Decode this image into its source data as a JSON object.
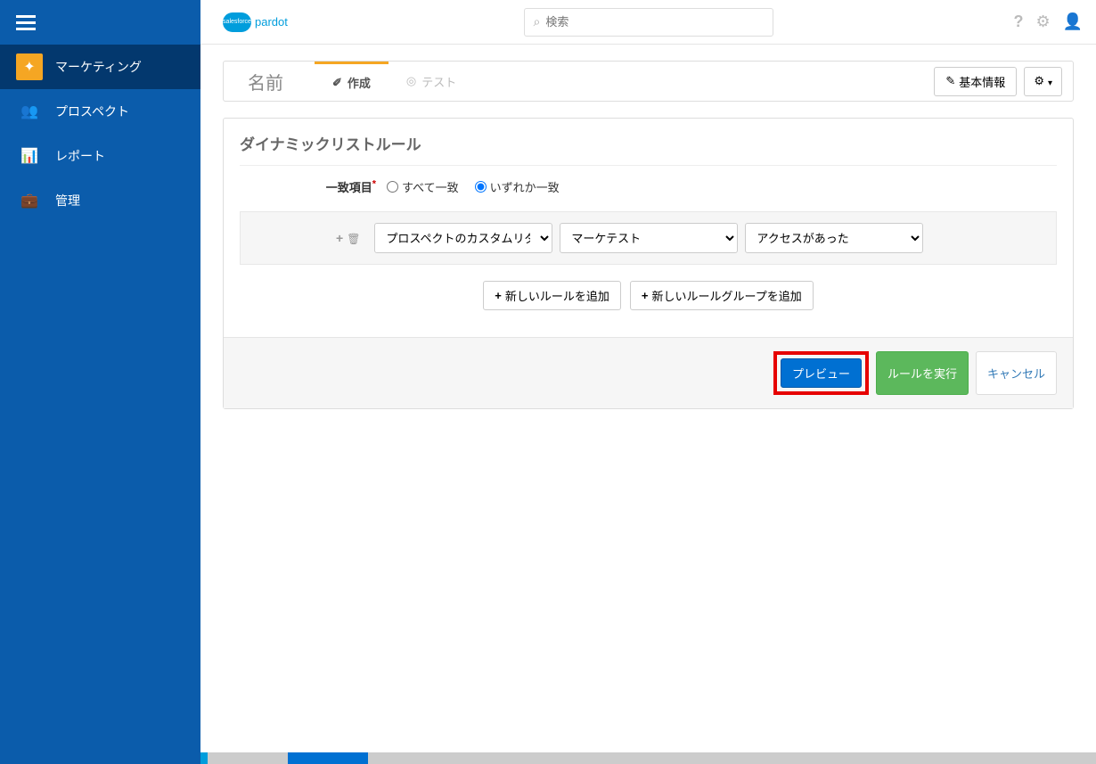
{
  "sidebar": {
    "items": [
      {
        "label": "マーケティング"
      },
      {
        "label": "プロスペクト"
      },
      {
        "label": "レポート"
      },
      {
        "label": "管理"
      }
    ]
  },
  "logo": {
    "cloud": "salesforce",
    "product": "pardot"
  },
  "search": {
    "placeholder": "検索"
  },
  "header": {
    "title": "名前",
    "tab_create": "作成",
    "tab_test": "テスト",
    "basic_info": "基本情報"
  },
  "rules": {
    "title": "ダイナミックリストルール",
    "match_label": "一致項目",
    "match_all": "すべて一致",
    "match_any": "いずれか一致",
    "select1": "プロスペクトのカスタムリダ",
    "select2": "マーケテスト",
    "select3": "アクセスがあった",
    "add_rule": "新しいルールを追加",
    "add_group": "新しいルールグループを追加"
  },
  "footer": {
    "preview": "プレビュー",
    "run": "ルールを実行",
    "cancel": "キャンセル"
  }
}
